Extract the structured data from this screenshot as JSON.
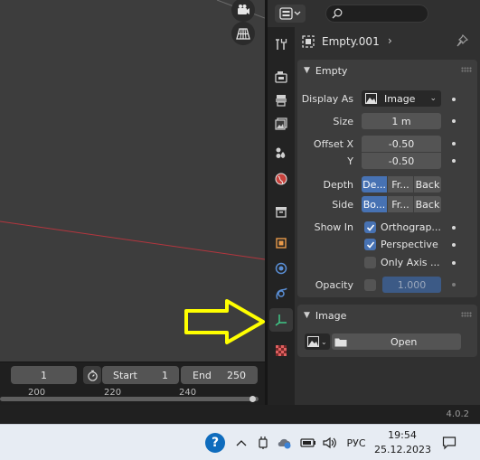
{
  "viewport": {
    "nav_icons": [
      "camera-icon",
      "grid-icon"
    ]
  },
  "timeline": {
    "current_frame": "1",
    "start_label": "Start",
    "start_value": "1",
    "end_label": "End",
    "end_value": "250",
    "frame_marks": [
      "200",
      "220",
      "240"
    ]
  },
  "properties": {
    "header": {
      "editor_type_icon": "properties-editor-icon",
      "search_placeholder": ""
    },
    "breadcrumb": {
      "object_name": "Empty.001",
      "pin_icon": "pin-icon"
    },
    "tabs": [
      {
        "name": "tool",
        "icon": "tool-icon"
      },
      {
        "name": "render",
        "icon": "render-icon"
      },
      {
        "name": "output",
        "icon": "output-icon"
      },
      {
        "name": "view-layer",
        "icon": "view-layer-icon"
      },
      {
        "name": "scene",
        "icon": "scene-icon"
      },
      {
        "name": "world",
        "icon": "world-icon"
      },
      {
        "name": "collection",
        "icon": "collection-icon"
      },
      {
        "name": "object",
        "icon": "object-icon"
      },
      {
        "name": "physics",
        "icon": "physics-icon"
      },
      {
        "name": "constraints",
        "icon": "constraints-icon"
      },
      {
        "name": "object-data",
        "icon": "empty-data-icon",
        "active": true
      },
      {
        "name": "texture",
        "icon": "texture-icon"
      }
    ],
    "empty_panel": {
      "title": "Empty",
      "display_as_label": "Display As",
      "display_as_value": "Image",
      "size_label": "Size",
      "size_value": "1 m",
      "offset_x_label": "Offset X",
      "offset_x_value": "-0.50",
      "offset_y_label": "Y",
      "offset_y_value": "-0.50",
      "depth_label": "Depth",
      "depth_options": [
        "De...",
        "Fr...",
        "Back"
      ],
      "side_label": "Side",
      "side_options": [
        "Bo...",
        "Fr...",
        "Back"
      ],
      "show_in_label": "Show In",
      "show_in_options": [
        {
          "label": "Orthograp...",
          "checked": true
        },
        {
          "label": "Perspective",
          "checked": true
        },
        {
          "label": "Only Axis ...",
          "checked": false
        }
      ],
      "opacity_label": "Opacity",
      "opacity_value": "1.000"
    },
    "image_panel": {
      "title": "Image",
      "open_label": "Open"
    }
  },
  "status": {
    "version": "4.0.2"
  },
  "taskbar": {
    "language": "РУС",
    "time": "19:54",
    "date": "25.12.2023"
  },
  "annotation": {
    "arrow_color": "#ffff00"
  },
  "colors": {
    "accent_blue": "#4772b3",
    "x_axis_red": "#b4363e"
  }
}
